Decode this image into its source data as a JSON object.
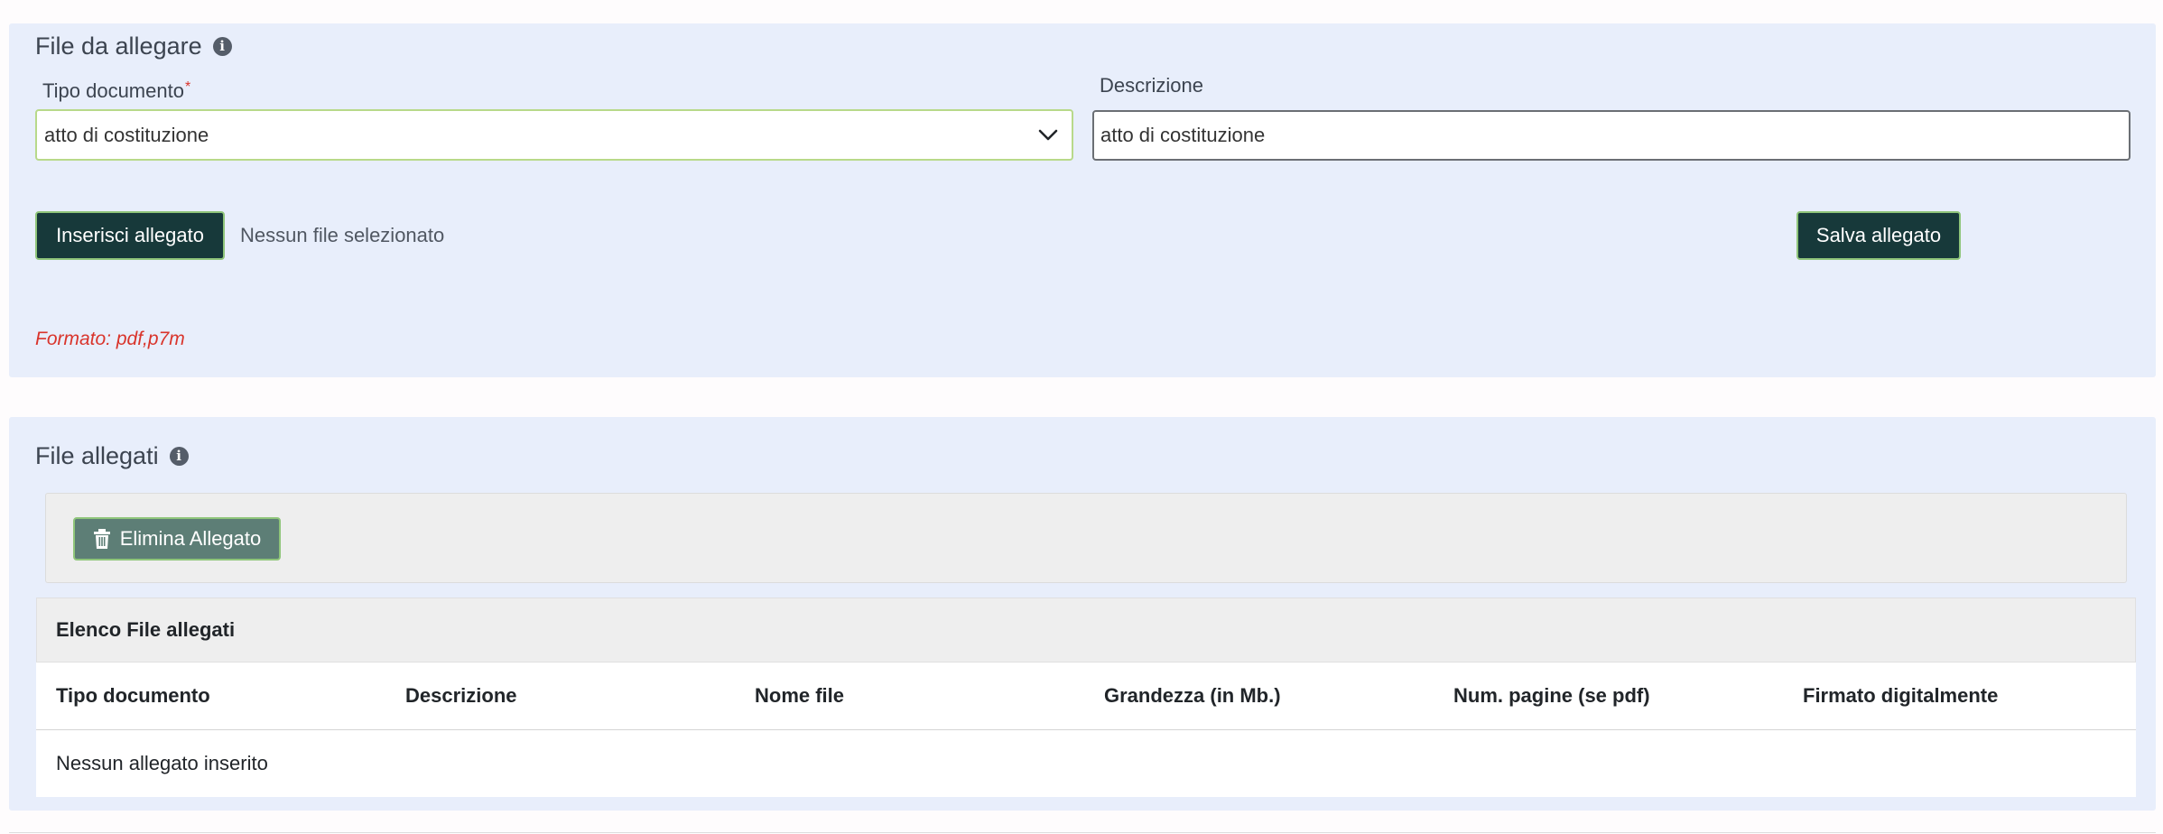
{
  "upload": {
    "title": "File da allegare",
    "doc_type_label": "Tipo documento",
    "doc_type_required": "*",
    "doc_type_value": "atto di costituzione",
    "description_label": "Descrizione",
    "description_value": "atto di costituzione",
    "insert_button": "Inserisci allegato",
    "no_file_text": "Nessun file selezionato",
    "save_button": "Salva allegato",
    "format_note": "Formato: pdf,p7m"
  },
  "attached": {
    "title": "File allegati",
    "delete_button": "Elimina Allegato",
    "list_title": "Elenco File allegati",
    "columns": [
      "Tipo documento",
      "Descrizione",
      "Nome file",
      "Grandezza (in Mb.)",
      "Num. pagine (se pdf)",
      "Firmato digitalmente"
    ],
    "empty_message": "Nessun allegato inserito"
  },
  "icons": {
    "info": "info-icon",
    "chevron": "chevron-down-icon",
    "trash": "trash-icon"
  },
  "colors": {
    "panel_bg": "#e8eefb",
    "button_dark": "#17393a",
    "button_delete": "#5d7e76",
    "button_border": "#8fc57a",
    "error_red": "#d9342b"
  }
}
